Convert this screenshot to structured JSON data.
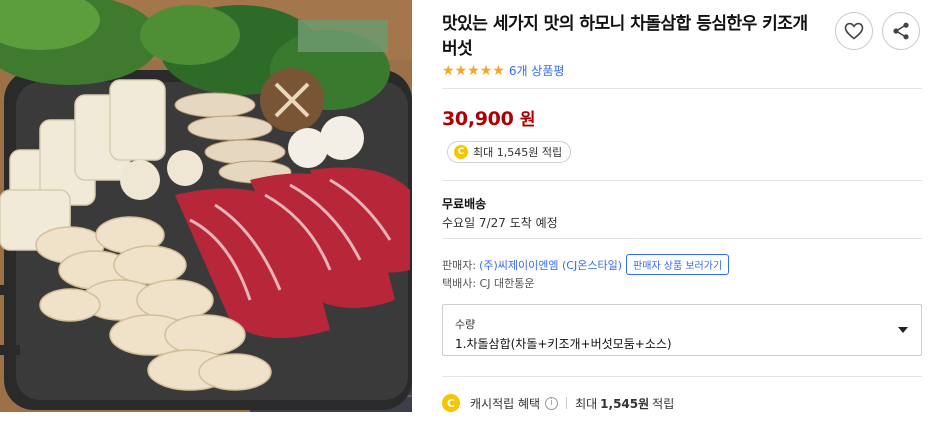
{
  "product": {
    "title": "맛있는 세가지 맛의 하모니 차돌삼합 등심한우 키조개 버섯",
    "rating": 5,
    "review_count": "6개 상품평",
    "price": "30,900",
    "price_unit": "원",
    "points_prefix": "최대",
    "points_amount": "1,545원",
    "points_suffix": "적립",
    "coin_symbol": "C"
  },
  "shipping": {
    "label": "무료배송",
    "arrival": "수요일 7/27 도착 예정"
  },
  "seller": {
    "prefix": "판매자:",
    "name": "(주)씨제이이엔엠 (CJ온스타일)",
    "button": "판매자 상품 보러가기",
    "courier": "택배사: CJ 대한통운"
  },
  "option": {
    "label": "수량",
    "value": "1.차돌삼합(차돌+키조개+버섯모둠+소스)"
  },
  "cash": {
    "label": "캐시적립 혜택",
    "prefix": "최대",
    "amount": "1,545원",
    "suffix": "적립"
  },
  "colors": {
    "price": "#ae0000",
    "link": "#346aff",
    "star": "#f5a623",
    "coin": "#f7c600"
  },
  "icons": {
    "wish": "heart-icon",
    "share": "share-icon",
    "option": "caret-down-icon",
    "info": "info-icon"
  }
}
